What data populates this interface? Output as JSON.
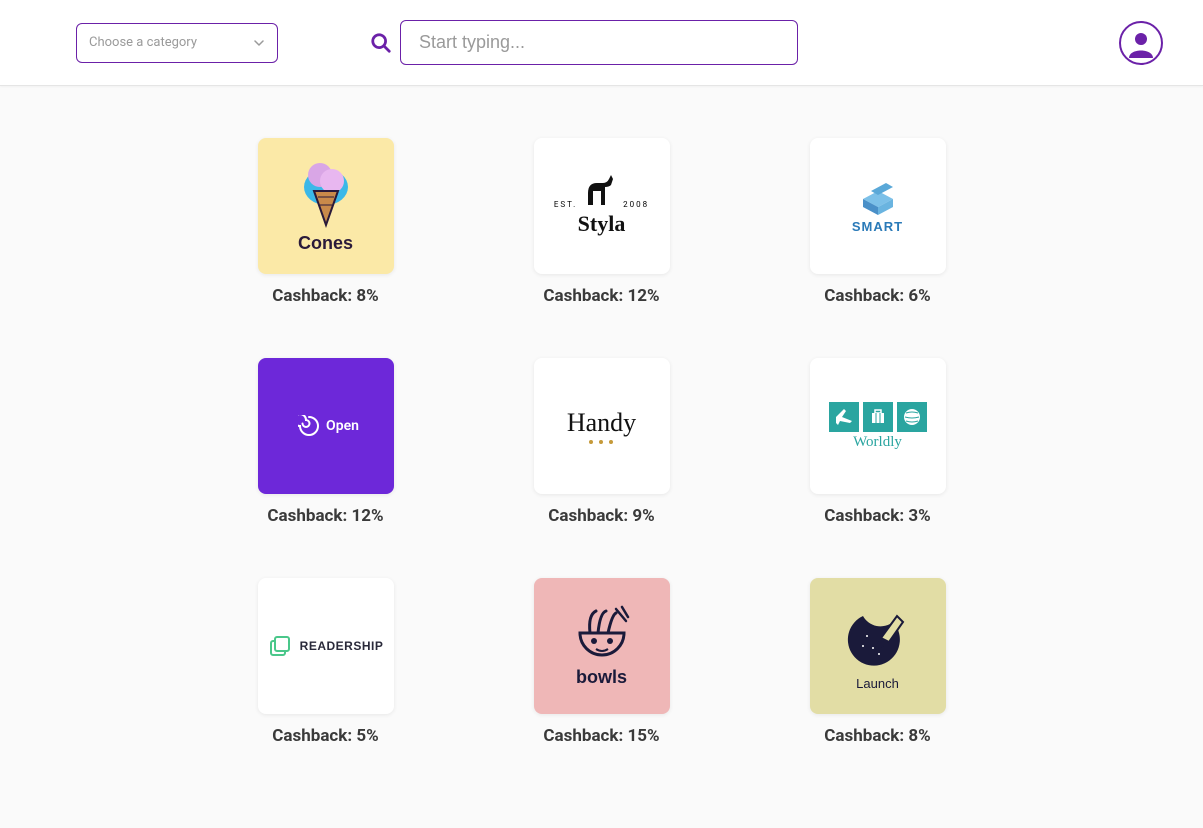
{
  "header": {
    "category_placeholder": "Choose a category",
    "search_placeholder": "Start typing..."
  },
  "cashback_label": "Cashback: ",
  "merchants": [
    {
      "name": "Cones",
      "cashback": "8%",
      "bg": "bg-cream",
      "icon": "cones"
    },
    {
      "name": "Styla",
      "cashback": "12%",
      "bg": "",
      "icon": "styla",
      "est": "EST.",
      "year": "2008"
    },
    {
      "name": "SMART",
      "cashback": "6%",
      "bg": "",
      "icon": "smart"
    },
    {
      "name": "Open",
      "cashback": "12%",
      "bg": "bg-violet",
      "icon": "open"
    },
    {
      "name": "Handy",
      "cashback": "9%",
      "bg": "",
      "icon": "handy"
    },
    {
      "name": "Worldly",
      "cashback": "3%",
      "bg": "",
      "icon": "worldly"
    },
    {
      "name": "READERSHIP",
      "cashback": "5%",
      "bg": "",
      "icon": "readership"
    },
    {
      "name": "bowls",
      "cashback": "15%",
      "bg": "bg-pink",
      "icon": "bowls"
    },
    {
      "name": "Launch",
      "cashback": "8%",
      "bg": "bg-sand",
      "icon": "launch"
    }
  ]
}
